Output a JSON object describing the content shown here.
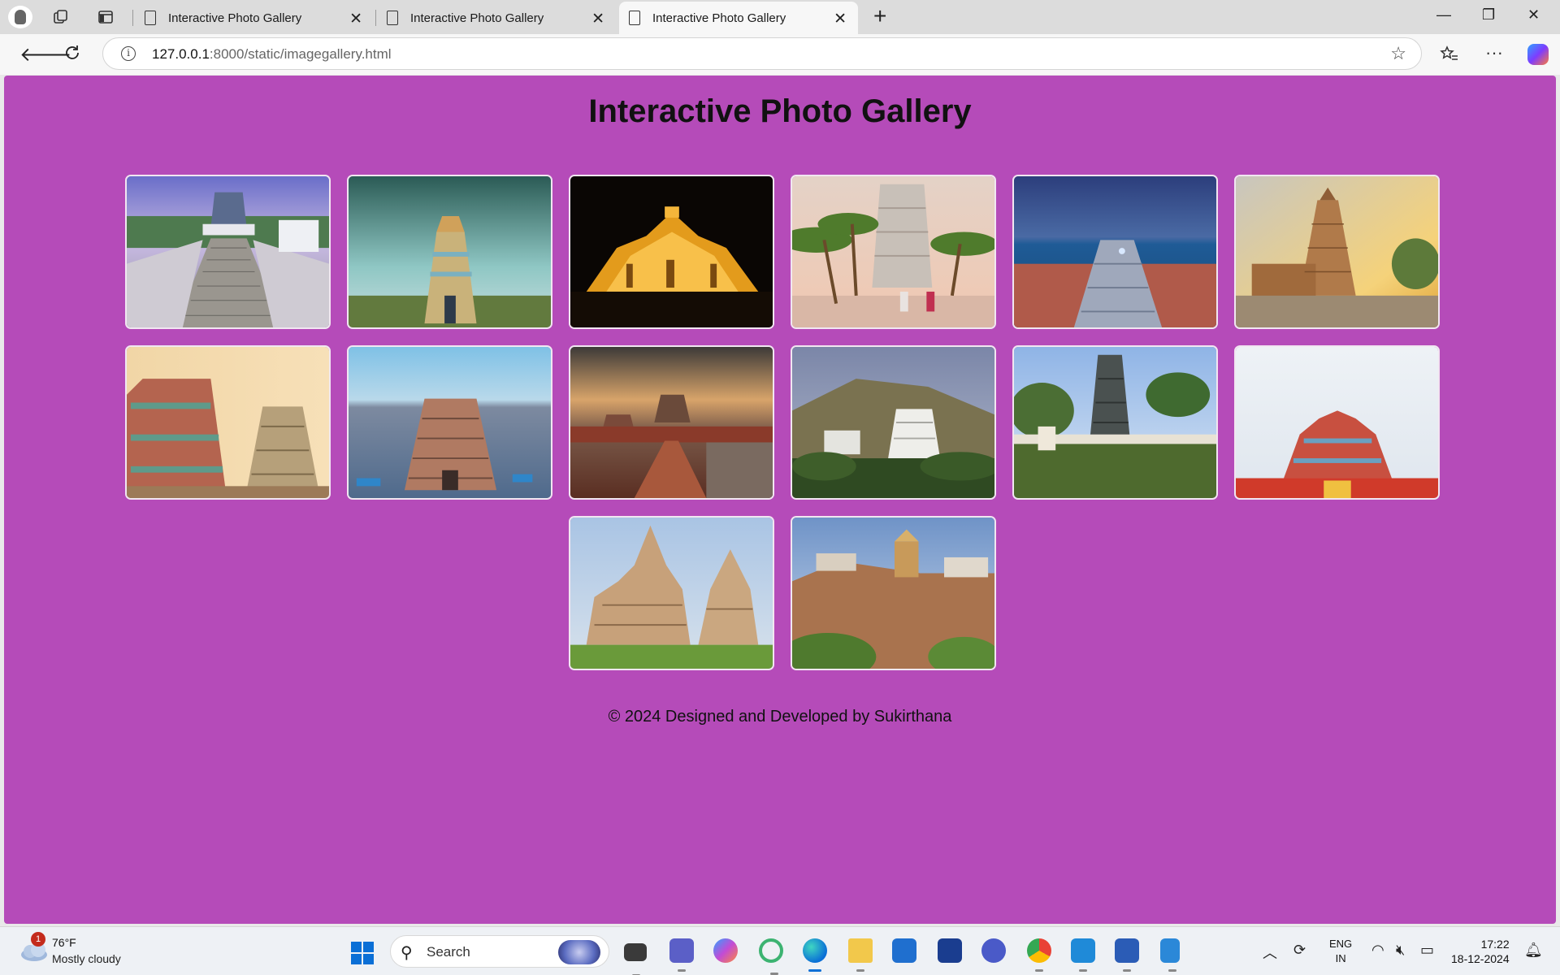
{
  "browser": {
    "tabs": [
      {
        "title": "Interactive Photo Gallery",
        "active": false
      },
      {
        "title": "Interactive Photo Gallery",
        "active": false
      },
      {
        "title": "Interactive Photo Gallery",
        "active": true
      }
    ],
    "url_host": "127.0.0.1",
    "url_rest": ":8000/static/imagegallery.html",
    "new_tab_label": "+",
    "minimize_label": "—",
    "restore_label": "❐",
    "close_label": "✕"
  },
  "page": {
    "title": "Interactive Photo Gallery",
    "background_color": "#b54bb9",
    "photos": [
      {
        "name": "temple-steps-photo",
        "icon": "image-icon"
      },
      {
        "name": "gopuram-green-sky-photo",
        "icon": "image-icon"
      },
      {
        "name": "temple-night-lights-photo",
        "icon": "image-icon"
      },
      {
        "name": "temple-palm-road-photo",
        "icon": "image-icon"
      },
      {
        "name": "shore-temple-sea-photo",
        "icon": "image-icon"
      },
      {
        "name": "brihadeeswara-temple-photo",
        "icon": "image-icon"
      },
      {
        "name": "colorful-gopurams-photo",
        "icon": "image-icon"
      },
      {
        "name": "temple-aerial-city-photo",
        "icon": "image-icon"
      },
      {
        "name": "temple-tank-sunset-photo",
        "icon": "image-icon"
      },
      {
        "name": "white-hill-temple-photo",
        "icon": "image-icon"
      },
      {
        "name": "temple-pond-photo",
        "icon": "image-icon"
      },
      {
        "name": "red-gopuram-photo",
        "icon": "image-icon"
      },
      {
        "name": "khajuraho-temple-photo",
        "icon": "image-icon"
      },
      {
        "name": "rock-fort-temple-photo",
        "icon": "image-icon"
      }
    ],
    "footer": "© 2024 Designed and Developed by Sukirthana"
  },
  "taskbar": {
    "weather_temp": "76°F",
    "weather_condition": "Mostly cloudy",
    "weather_badge": "1",
    "search_placeholder": "Search",
    "lang_line1": "ENG",
    "lang_line2": "IN",
    "time": "17:22",
    "date": "18-12-2024"
  }
}
